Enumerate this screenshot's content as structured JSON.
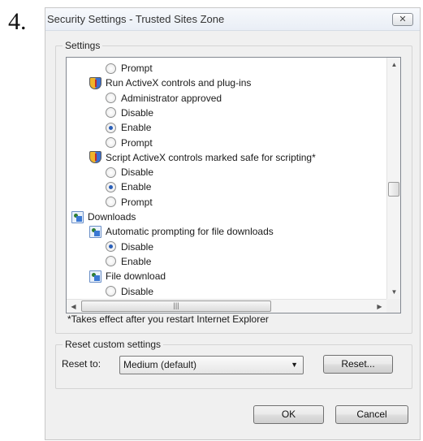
{
  "step_number": "4.",
  "window": {
    "title": "Security Settings - Trusted Sites Zone",
    "close_glyph": "✕"
  },
  "settings_group": {
    "label": "Settings",
    "rows": [
      {
        "type": "radio",
        "label": "Prompt",
        "checked": false,
        "indent": 1
      },
      {
        "type": "category",
        "label": "Run ActiveX controls and plug-ins",
        "icon": "shield-icon",
        "indent": 0
      },
      {
        "type": "radio",
        "label": "Administrator approved",
        "checked": false,
        "indent": 1
      },
      {
        "type": "radio",
        "label": "Disable",
        "checked": false,
        "indent": 1
      },
      {
        "type": "radio",
        "label": "Enable",
        "checked": true,
        "indent": 1
      },
      {
        "type": "radio",
        "label": "Prompt",
        "checked": false,
        "indent": 1
      },
      {
        "type": "category",
        "label": "Script ActiveX controls marked safe for scripting*",
        "icon": "shield-icon",
        "indent": 0
      },
      {
        "type": "radio",
        "label": "Disable",
        "checked": false,
        "indent": 1
      },
      {
        "type": "radio",
        "label": "Enable",
        "checked": true,
        "indent": 1
      },
      {
        "type": "radio",
        "label": "Prompt",
        "checked": false,
        "indent": 1
      },
      {
        "type": "section",
        "label": "Downloads",
        "icon": "downloads-icon",
        "indent": -1
      },
      {
        "type": "category",
        "label": "Automatic prompting for file downloads",
        "icon": "downloads-icon",
        "indent": 0
      },
      {
        "type": "radio",
        "label": "Disable",
        "checked": true,
        "indent": 1
      },
      {
        "type": "radio",
        "label": "Enable",
        "checked": false,
        "indent": 1
      },
      {
        "type": "category",
        "label": "File download",
        "icon": "downloads-icon",
        "indent": 0
      },
      {
        "type": "radio",
        "label": "Disable",
        "checked": false,
        "indent": 1
      }
    ],
    "note": "*Takes effect after you restart Internet Explorer"
  },
  "reset_group": {
    "label": "Reset custom settings",
    "reset_to_label": "Reset to:",
    "selected_level": "Medium (default)",
    "reset_button": "Reset..."
  },
  "buttons": {
    "ok": "OK",
    "cancel": "Cancel"
  }
}
